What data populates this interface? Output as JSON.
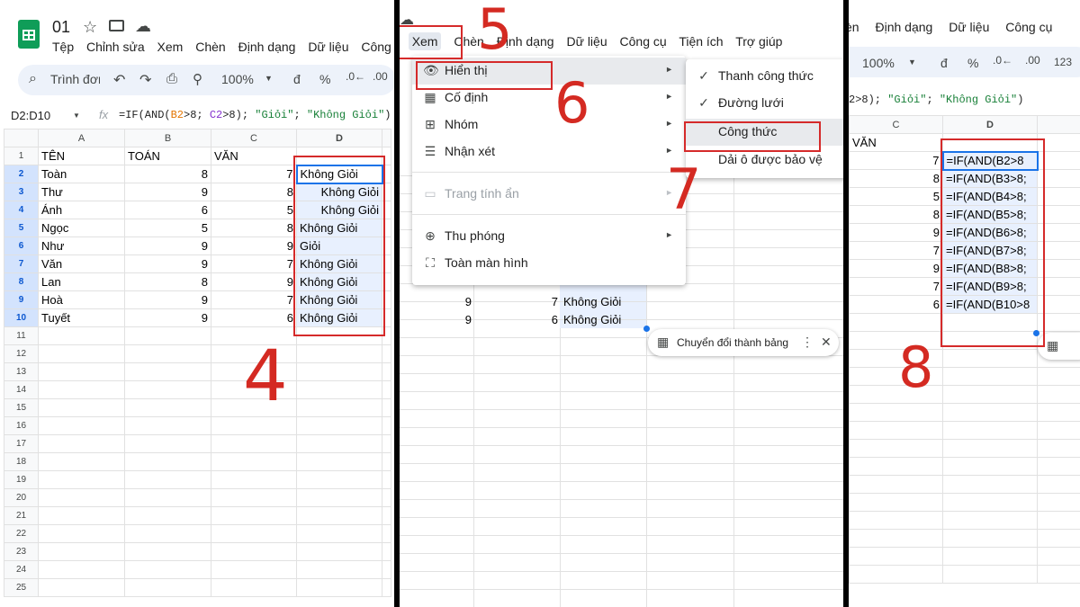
{
  "panel1": {
    "doc_title": "01",
    "menu": [
      "Tệp",
      "Chỉnh sửa",
      "Xem",
      "Chèn",
      "Định dạng",
      "Dữ liệu",
      "Công cụ"
    ],
    "search_placeholder": "Trình đơn",
    "zoom": "100%",
    "more_label": ".00",
    "name_box": "D2:D10",
    "fx": "fx",
    "formula_parts": [
      "=IF(AND(",
      "B2",
      ">8; ",
      "C2",
      ">8); ",
      "\"Giỏi\"",
      "; ",
      "\"Không Giỏi\"",
      ")"
    ],
    "columns": [
      "A",
      "B",
      "C",
      "D"
    ],
    "rows": [
      {
        "n": "1",
        "a": "TÊN",
        "b": "TOÁN",
        "c": "VĂN",
        "d": ""
      },
      {
        "n": "2",
        "a": "Toàn",
        "b": "8",
        "c": "7",
        "d": "Không Giỏi"
      },
      {
        "n": "3",
        "a": "Thư",
        "b": "9",
        "c": "8",
        "d": "Không Giỏi"
      },
      {
        "n": "4",
        "a": "Ánh",
        "b": "6",
        "c": "5",
        "d": "Không Giỏi"
      },
      {
        "n": "5",
        "a": "Ngọc",
        "b": "5",
        "c": "8",
        "d": "Không Giỏi"
      },
      {
        "n": "6",
        "a": "Như",
        "b": "9",
        "c": "9",
        "d": "Giỏi"
      },
      {
        "n": "7",
        "a": "Văn",
        "b": "9",
        "c": "7",
        "d": "Không Giỏi"
      },
      {
        "n": "8",
        "a": "Lan",
        "b": "8",
        "c": "9",
        "d": "Không Giỏi"
      },
      {
        "n": "9",
        "a": "Hoà",
        "b": "9",
        "c": "7",
        "d": "Không Giỏi"
      },
      {
        "n": "10",
        "a": "Tuyết",
        "b": "9",
        "c": "6",
        "d": "Không Giỏi"
      }
    ],
    "empty_rows": [
      "11",
      "12",
      "13",
      "14",
      "15",
      "16",
      "17",
      "18",
      "19",
      "20",
      "21",
      "22",
      "23",
      "24",
      "25"
    ],
    "step": "4"
  },
  "panel2": {
    "menu": [
      "a",
      "Xem",
      "Chèn",
      "Định dạng",
      "Dữ liệu",
      "Công cụ",
      "Tiện ích",
      "Trợ giúp"
    ],
    "view_menu": [
      {
        "icon": "👁",
        "label": "Hiển thị",
        "arrow": "►",
        "disabled": false
      },
      {
        "icon": "▦",
        "label": "Cố định",
        "arrow": "►",
        "disabled": false
      },
      {
        "icon": "⊞",
        "label": "Nhóm",
        "arrow": "►",
        "disabled": false
      },
      {
        "icon": "☰",
        "label": "Nhận xét",
        "arrow": "►",
        "disabled": false
      },
      {
        "icon": "▭",
        "label": "Trang tính ẩn",
        "arrow": "►",
        "disabled": true
      },
      {
        "icon": "⊕",
        "label": "Thu phóng",
        "arrow": "►",
        "disabled": false
      },
      {
        "icon": "⛶",
        "label": "Toàn màn hình",
        "arrow": "",
        "disabled": false
      }
    ],
    "submenu": [
      {
        "check": "✓",
        "label": "Thanh công thức"
      },
      {
        "check": "✓",
        "label": "Đường lưới"
      },
      {
        "check": "",
        "label": "Công thức"
      },
      {
        "check": "",
        "label": "Dải ô được bảo vệ"
      }
    ],
    "visible_rows": [
      {
        "b": "9",
        "c": "7",
        "d": "Không Giỏi"
      },
      {
        "b": "9",
        "c": "6",
        "d": "Không Giỏi"
      }
    ],
    "chip_label": "Chuyển đổi thành bảng",
    "steps": [
      "5",
      "6",
      "7"
    ]
  },
  "panel3": {
    "menu": [
      "èn",
      "Định dạng",
      "Dữ liệu",
      "Công cụ"
    ],
    "zoom": "100%",
    "toolbar_extra": "123",
    "formula_parts": [
      "2>8",
      "); ",
      "\"Giỏi\"",
      "; ",
      "\"Không Giỏi\"",
      ")"
    ],
    "columns": [
      "C",
      "D"
    ],
    "rows": [
      {
        "c": "VĂN",
        "d": ""
      },
      {
        "c": "7",
        "d": "=IF(AND(B2>8"
      },
      {
        "c": "8",
        "d": "=IF(AND(B3>8; "
      },
      {
        "c": "5",
        "d": "=IF(AND(B4>8; "
      },
      {
        "c": "8",
        "d": "=IF(AND(B5>8; "
      },
      {
        "c": "9",
        "d": "=IF(AND(B6>8; "
      },
      {
        "c": "7",
        "d": "=IF(AND(B7>8; "
      },
      {
        "c": "9",
        "d": "=IF(AND(B8>8; "
      },
      {
        "c": "7",
        "d": "=IF(AND(B9>8; "
      },
      {
        "c": "6",
        "d": "=IF(AND(B10>8"
      }
    ],
    "step": "8"
  },
  "colors": {
    "accent": "#1a73e8",
    "annotation": "#d52a2a",
    "selection": "#e8f0fe",
    "sheets_green": "#0f9d58"
  }
}
